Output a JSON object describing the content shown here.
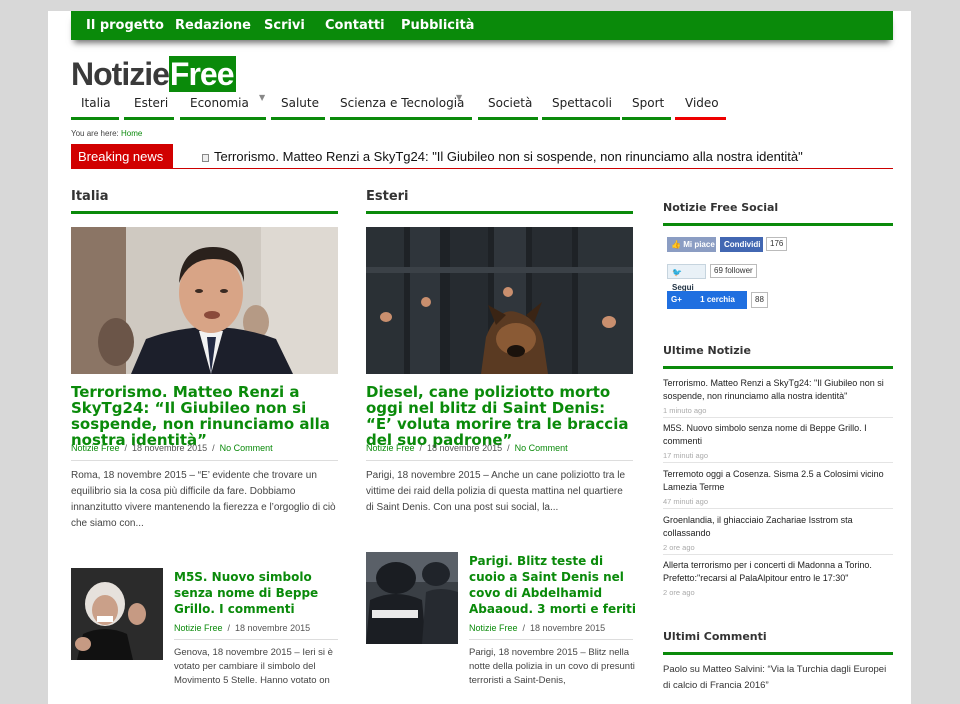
{
  "top_nav": [
    "Il progetto",
    "Redazione",
    "Scrivi",
    "Contatti",
    "Pubblicità"
  ],
  "logo": {
    "part1": "Notizie",
    "part2": "Free"
  },
  "main_nav": [
    "Italia",
    "Esteri",
    "Economia",
    "Salute",
    "Scienza e Tecnologia",
    "Società",
    "Spettacoli",
    "Sport",
    "Video"
  ],
  "breadcrumb": {
    "prefix": "You are here:",
    "home": "Home"
  },
  "breaking": {
    "label": "Breaking news",
    "text": "Terrorismo. Matteo Renzi a SkyTg24: \"Il Giubileo non si sospende, non rinunciamo alla nostra identità\""
  },
  "sections": {
    "italia": "Italia",
    "esteri": "Esteri"
  },
  "articles": {
    "a1": {
      "title": "Terrorismo. Matteo Renzi a SkyTg24: “Il Giubileo non si sospende, non rinunciamo alla nostra identità”",
      "author": "Notizie Free",
      "date": "18 novembre 2015",
      "comments": "No Comment",
      "excerpt": "Roma, 18 novembre 2015 – “E’ evidente che trovare un equilibrio sia la cosa più difficile da fare. Dobbiamo innanzitutto vivere mantenendo la fierezza e l’orgoglio di ciò che siamo con..."
    },
    "a2": {
      "title": "Diesel, cane poliziotto morto oggi nel blitz di Saint Denis: “E’ voluta morire tra le braccia del suo padrone”",
      "author": "Notizie Free",
      "date": "18 novembre 2015",
      "comments": "No Comment",
      "excerpt": "Parigi, 18 novembre 2015 – Anche un cane poliziotto tra le vittime dei raid della polizia di questa mattina nel quartiere di Saint Denis. Con una post sui social, la..."
    },
    "a3": {
      "title": "M5S. Nuovo simbolo senza nome di Beppe Grillo. I commenti",
      "author": "Notizie Free",
      "date": "18 novembre 2015",
      "excerpt": "Genova, 18 novembre 2015 – Ieri si è votato per cambiare il simbolo del Movimento 5 Stelle. Hanno votato on"
    },
    "a4": {
      "title": "Parigi. Blitz teste di cuoio a Saint Denis nel covo di Abdelhamid Abaaoud. 3 morti e feriti",
      "author": "Notizie Free",
      "date": "18 novembre 2015",
      "excerpt": "Parigi, 18 novembre 2015 – Blitz nella notte della polizia in un covo di presunti terroristi a Saint-Denis,"
    }
  },
  "sidebar": {
    "social_title": "Notizie Free Social",
    "fb_like": "Mi piace",
    "fb_share": "Condividi",
    "fb_count": "176",
    "tw_follow": "Segui",
    "tw_count": "69 follower",
    "gp_label": "1 cerchia",
    "gp_count": "88",
    "latest_title": "Ultime Notizie",
    "latest": [
      {
        "title": "Terrorismo. Matteo Renzi a SkyTg24: \"Il Giubileo non si sospende, non rinunciamo alla nostra identità\"",
        "ago": "1 minuto ago"
      },
      {
        "title": "M5S. Nuovo simbolo senza nome di Beppe Grillo. I commenti",
        "ago": "17 minuti ago"
      },
      {
        "title": "Terremoto oggi a Cosenza. Sisma 2.5 a Colosimi vicino Lamezia Terme",
        "ago": "47 minuti ago"
      },
      {
        "title": "Groenlandia, il ghiacciaio Zachariae Isstrom sta collassando",
        "ago": "2 ore ago"
      },
      {
        "title": "Allerta terrorismo per i concerti di Madonna a Torino. Prefetto:\"recarsi al PalaAlpitour entro le 17:30\"",
        "ago": "2 ore ago"
      }
    ],
    "comments_title": "Ultimi Commenti",
    "comment_text": "Paolo su Matteo Salvini: “Via la Turchia dagli Europei di calcio di Francia 2016”"
  },
  "colors": {
    "brand_green": "#0a8a0a",
    "breaking_red": "#d10000"
  }
}
